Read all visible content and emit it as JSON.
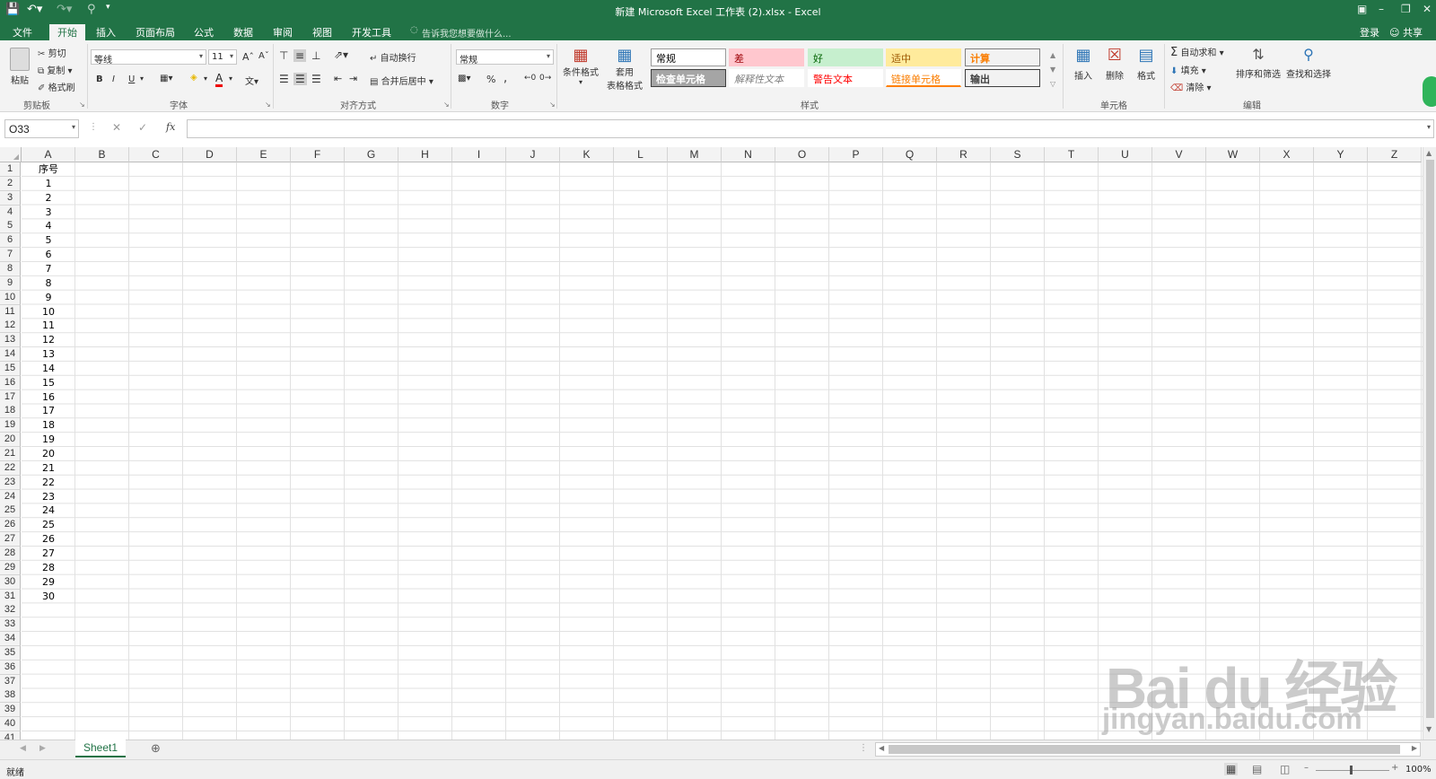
{
  "window": {
    "title": "新建 Microsoft Excel 工作表 (2).xlsx - Excel"
  },
  "tabs": [
    "文件",
    "开始",
    "插入",
    "页面布局",
    "公式",
    "数据",
    "审阅",
    "视图",
    "开发工具"
  ],
  "tellme": "告诉我您想要做什么...",
  "account": {
    "login": "登录",
    "share": "共享"
  },
  "clipboard": {
    "paste": "粘贴",
    "cut": "剪切",
    "copy": "复制",
    "format_painter": "格式刷",
    "label": "剪贴板"
  },
  "font": {
    "name": "等线",
    "size": "11",
    "bold": "B",
    "italic": "I",
    "underline": "U",
    "label": "字体"
  },
  "alignment": {
    "wrap": "自动换行",
    "merge": "合并后居中",
    "label": "对齐方式"
  },
  "number": {
    "format": "常规",
    "percent": "%",
    "comma": ",",
    "label": "数字"
  },
  "styles": {
    "conditional": "条件格式",
    "table_format": [
      "套用",
      "表格格式"
    ],
    "cells": [
      {
        "text": "常规",
        "bg": "#ffffff",
        "fg": "#000000",
        "border": "#9b9b9b"
      },
      {
        "text": "差",
        "bg": "#ffc7ce",
        "fg": "#9c0006",
        "border": "transparent"
      },
      {
        "text": "好",
        "bg": "#c6efce",
        "fg": "#006100",
        "border": "transparent"
      },
      {
        "text": "适中",
        "bg": "#ffeb9c",
        "fg": "#9c5700",
        "border": "transparent"
      },
      {
        "text": "计算",
        "bg": "#f2f2f2",
        "fg": "#fa7d00",
        "border": "#7f7f7f"
      },
      {
        "text": "检查单元格",
        "bg": "#a5a5a5",
        "fg": "#ffffff",
        "border": "#3f3f3f"
      },
      {
        "text": "解释性文本",
        "bg": "#ffffff",
        "fg": "#7f7f7f",
        "border": "transparent"
      },
      {
        "text": "警告文本",
        "bg": "#ffffff",
        "fg": "#ff0000",
        "border": "transparent"
      },
      {
        "text": "链接单元格",
        "bg": "#ffffff",
        "fg": "#fa7d00",
        "border": "transparent"
      },
      {
        "text": "输出",
        "bg": "#f2f2f2",
        "fg": "#3f3f3f",
        "border": "#3f3f3f"
      }
    ],
    "label": "样式"
  },
  "cells_group": {
    "insert": "插入",
    "delete": "删除",
    "format": "格式",
    "label": "单元格"
  },
  "editing": {
    "autosum": "自动求和",
    "fill": "填充",
    "clear": "清除",
    "sort": "排序和筛选",
    "find": "查找和选择",
    "label": "编辑"
  },
  "formula_bar": {
    "name_box": "O33",
    "fx": "fx",
    "content": ""
  },
  "columns": [
    "A",
    "B",
    "C",
    "D",
    "E",
    "F",
    "G",
    "H",
    "I",
    "J",
    "K",
    "L",
    "M",
    "N",
    "O",
    "P",
    "Q",
    "R",
    "S",
    "T",
    "U",
    "V",
    "W",
    "X",
    "Y",
    "Z"
  ],
  "rows": [
    "1",
    "2",
    "3",
    "4",
    "5",
    "6",
    "7",
    "8",
    "9",
    "10",
    "11",
    "12",
    "13",
    "14",
    "15",
    "16",
    "17",
    "18",
    "19",
    "20",
    "21",
    "22",
    "23",
    "24",
    "25",
    "26",
    "27",
    "28",
    "29",
    "30",
    "31",
    "32",
    "33",
    "34",
    "35",
    "36",
    "37",
    "38",
    "39",
    "40",
    "41"
  ],
  "column_a": [
    "序号",
    "1",
    "2",
    "3",
    "4",
    "5",
    "6",
    "7",
    "8",
    "9",
    "10",
    "11",
    "12",
    "13",
    "14",
    "15",
    "16",
    "17",
    "18",
    "19",
    "20",
    "21",
    "22",
    "23",
    "24",
    "25",
    "26",
    "27",
    "28",
    "29",
    "30"
  ],
  "sheet_tab": "Sheet1",
  "status": {
    "ready": "就绪",
    "zoom": "100%"
  },
  "watermark": {
    "brand": "Bai du 经验",
    "url": "jingyan.baidu.com"
  },
  "accent": "#217346"
}
